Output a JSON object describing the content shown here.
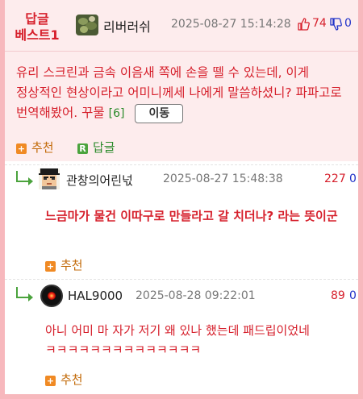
{
  "best": {
    "badge_line1": "답글",
    "badge_line2": "베스트1",
    "user": "리버러쉬",
    "date": "2025-08-27 15:14:28",
    "upvotes": "74",
    "downvotes": "0",
    "text": "유리 스크린과 금속 이음새 쪽에 손을 뗄 수 있는데, 이게 정상적인 현상이라고 어미니께세 나에게 말씀하셨니? 파파고로 번역해봤어. 꾸물",
    "reply_count": "[6]",
    "move_label": "이동",
    "recommend_label": "추천",
    "reply_label": "답글"
  },
  "comments": [
    {
      "user": "관창의어린넋",
      "date": "2025-08-27 15:48:38",
      "upvotes": "227",
      "downvotes": "0",
      "text": "느금마가 물건 이따구로 만들라고 갈 치더나? 라는 뜻이군",
      "recommend_label": "추천"
    },
    {
      "user": "HAL9000",
      "date": "2025-08-28 09:22:01",
      "upvotes": "89",
      "downvotes": "0",
      "text": "아니 어미 마 자가 저기 왜 있나 했는데 패드립이었네 ㅋㅋㅋㅋㅋㅋㅋㅋㅋㅋㅋㅋㅋㅋ",
      "recommend_label": "추천"
    }
  ],
  "colors": {
    "accent_red": "#d6202c",
    "border_pink": "#f7b8bd",
    "best_bg": "#fdeced",
    "vote_blue": "#2032c8",
    "recommend_orange": "#f08a24",
    "reply_green": "#4ba33d"
  },
  "icons": {
    "thumb_up": "thumbs-up-icon",
    "thumb_down": "thumbs-down-icon",
    "recommend": "plus-square-icon",
    "reply": "reply-r-icon",
    "reply_arrow": "reply-arrow-icon"
  }
}
